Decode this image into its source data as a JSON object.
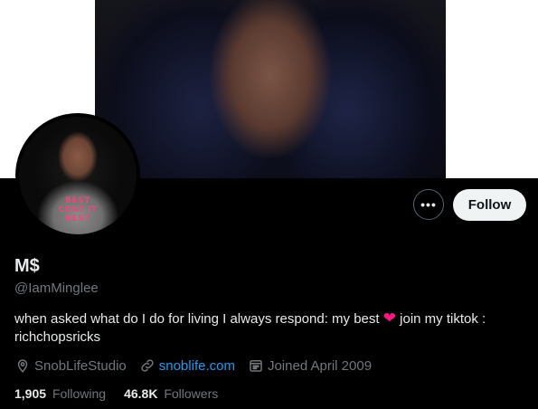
{
  "profile": {
    "name": "M$",
    "handle": "@IamMinglee",
    "bio_part1": "when asked what do I do for living I always respond: my best",
    "bio_heart": "❤",
    "bio_part2": "join my tiktok : richchopsricks",
    "avatar_shirt_text": "BEST COST IT BEST"
  },
  "actions": {
    "more_label": "•••",
    "follow_label": "Follow"
  },
  "meta": {
    "location": "SnobLifeStudio",
    "website": "snoblife.com",
    "joined": "Joined April 2009"
  },
  "stats": {
    "following_count": "1,905",
    "following_label": "Following",
    "followers_count": "46.8K",
    "followers_label": "Followers"
  },
  "icons": {
    "location": "location-pin-icon",
    "link": "link-icon",
    "calendar": "calendar-icon",
    "more": "more-dots-icon"
  },
  "colors": {
    "background": "#000000",
    "link": "#1d9bf0",
    "muted": "#71767b",
    "heart": "#f91880",
    "follow_bg": "#eff3f4"
  }
}
